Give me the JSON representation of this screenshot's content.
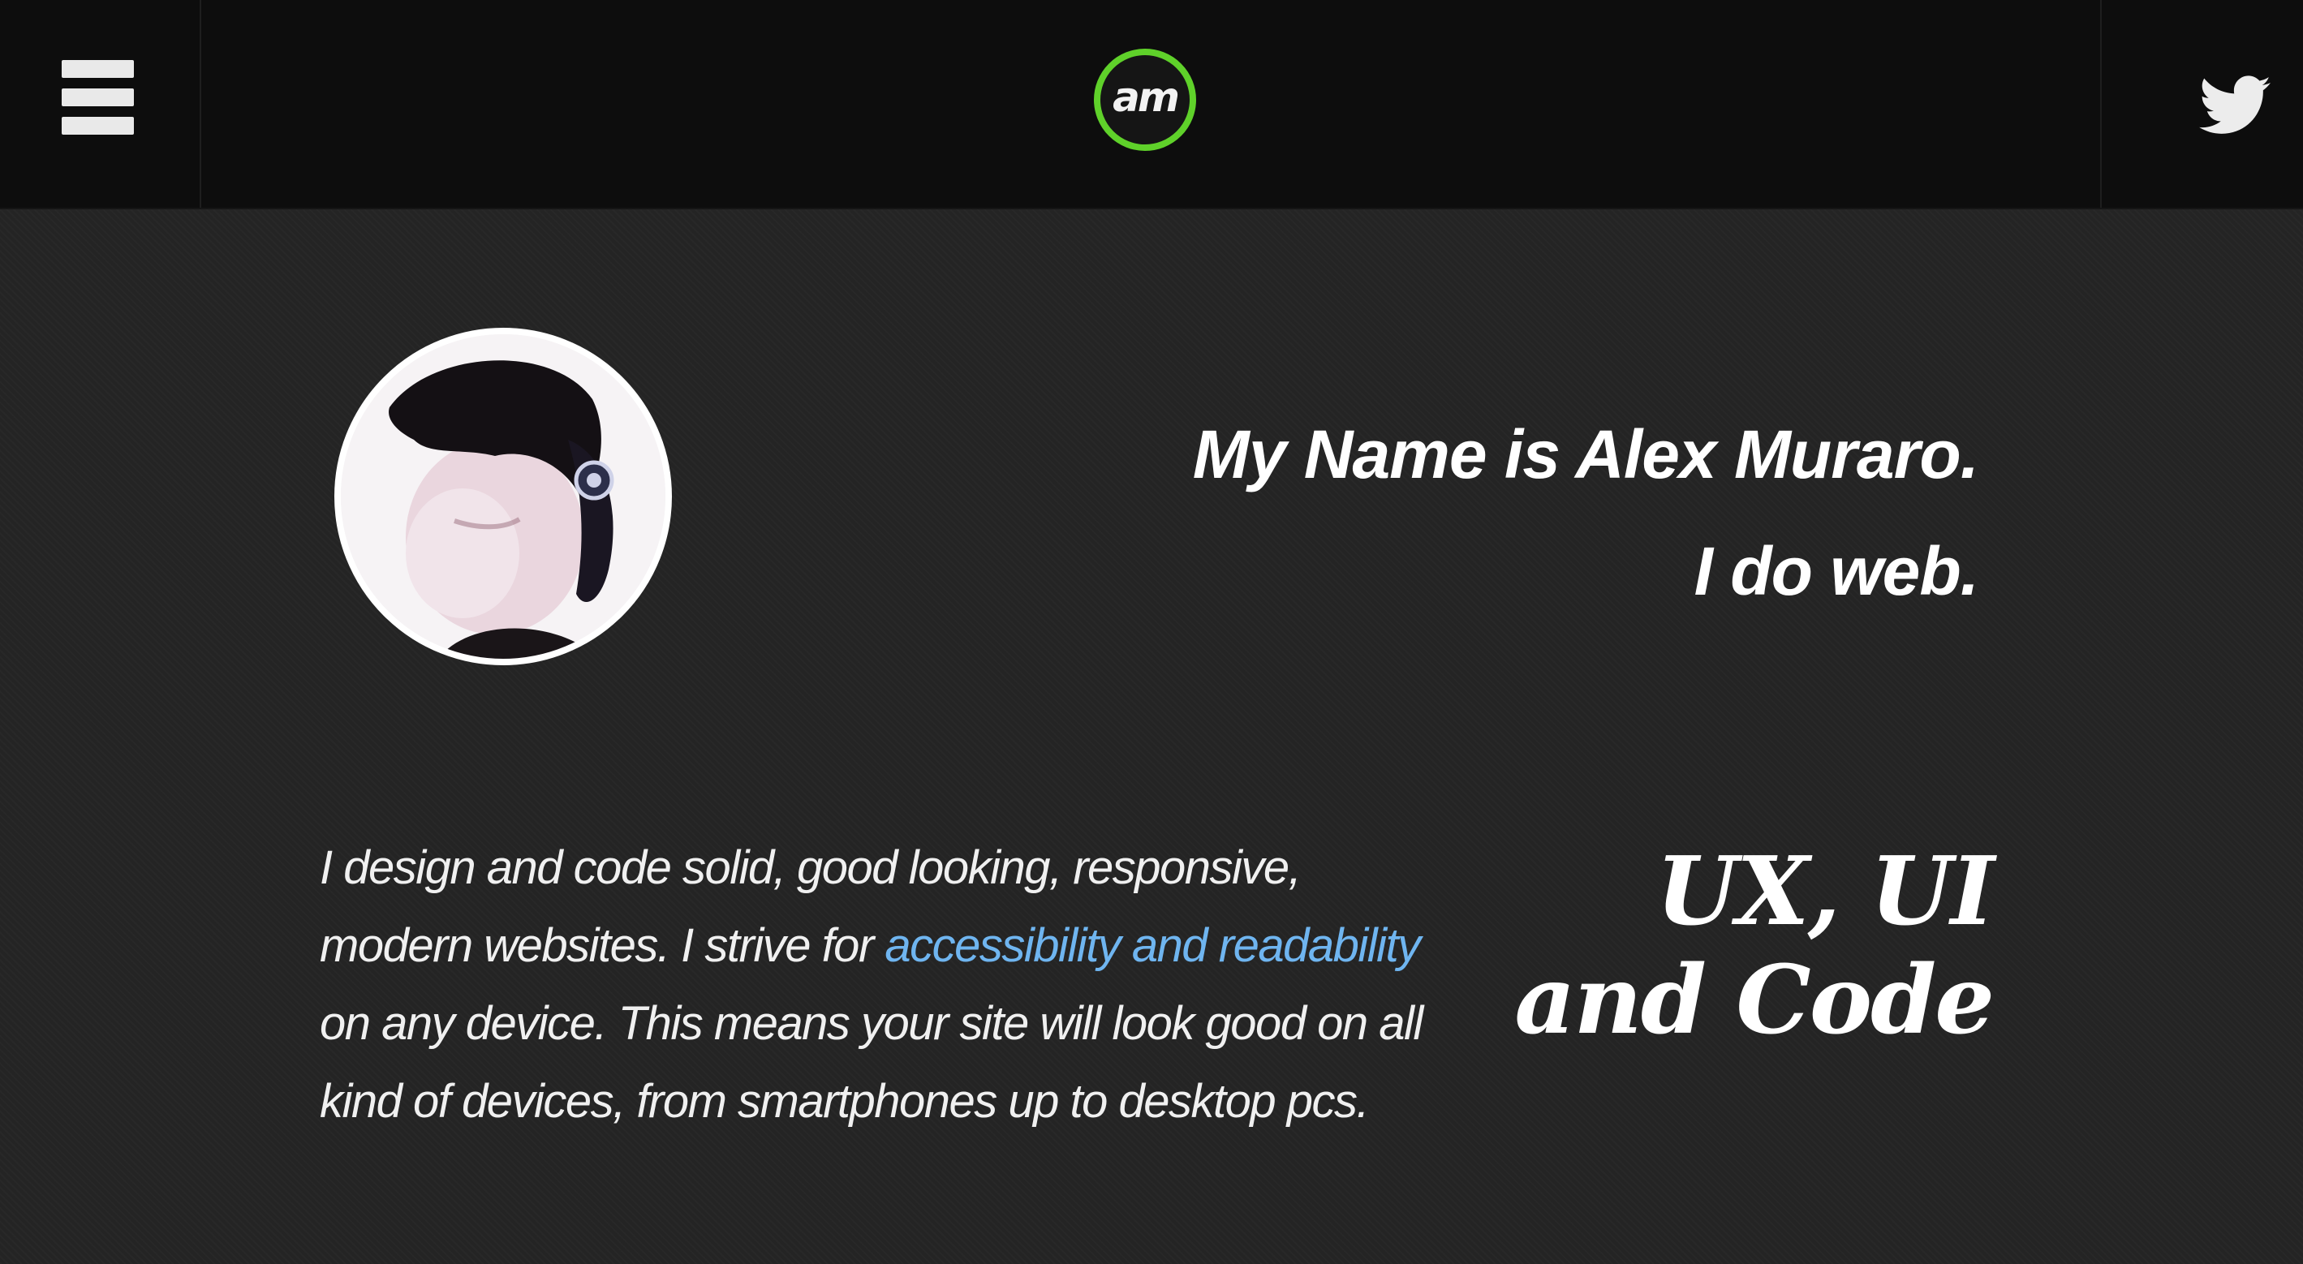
{
  "header": {
    "menu_icon": "hamburger-menu-icon",
    "logo_text": "am",
    "logo_ring_color": "#5fd12a",
    "social_icon": "twitter-bird-icon"
  },
  "hero": {
    "avatar_alt": "profile photo",
    "headline_line1": "My Name is Alex Muraro.",
    "headline_line2": "I do web."
  },
  "intro": {
    "text_before_link": "I design and code solid, good looking, responsive, modern websites. I strive for ",
    "link_text": "accessibility and readability",
    "text_after_link": " on any device. This means your site will look good on all kind of devices, from smartphones up to desktop pcs.",
    "link_color": "#6fb5f0"
  },
  "skills": {
    "line1": "UX, UI",
    "line2": "and Code"
  }
}
